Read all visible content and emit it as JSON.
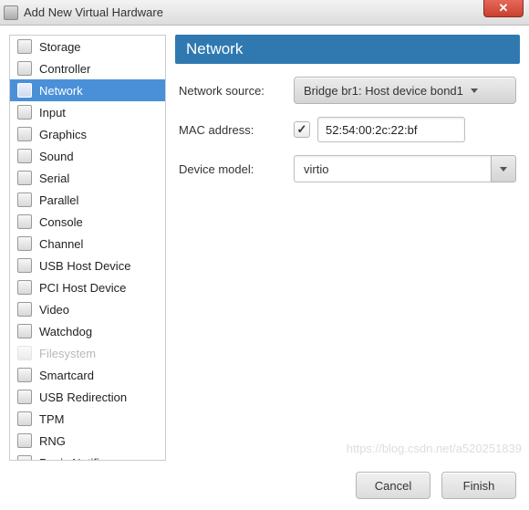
{
  "window": {
    "title": "Add New Virtual Hardware"
  },
  "sidebar": {
    "items": [
      {
        "label": "Storage",
        "icon": "storage-icon",
        "selected": false,
        "disabled": false
      },
      {
        "label": "Controller",
        "icon": "controller-icon",
        "selected": false,
        "disabled": false
      },
      {
        "label": "Network",
        "icon": "network-icon",
        "selected": true,
        "disabled": false
      },
      {
        "label": "Input",
        "icon": "input-icon",
        "selected": false,
        "disabled": false
      },
      {
        "label": "Graphics",
        "icon": "graphics-icon",
        "selected": false,
        "disabled": false
      },
      {
        "label": "Sound",
        "icon": "sound-icon",
        "selected": false,
        "disabled": false
      },
      {
        "label": "Serial",
        "icon": "serial-icon",
        "selected": false,
        "disabled": false
      },
      {
        "label": "Parallel",
        "icon": "parallel-icon",
        "selected": false,
        "disabled": false
      },
      {
        "label": "Console",
        "icon": "console-icon",
        "selected": false,
        "disabled": false
      },
      {
        "label": "Channel",
        "icon": "channel-icon",
        "selected": false,
        "disabled": false
      },
      {
        "label": "USB Host Device",
        "icon": "usb-icon",
        "selected": false,
        "disabled": false
      },
      {
        "label": "PCI Host Device",
        "icon": "pci-icon",
        "selected": false,
        "disabled": false
      },
      {
        "label": "Video",
        "icon": "video-icon",
        "selected": false,
        "disabled": false
      },
      {
        "label": "Watchdog",
        "icon": "watchdog-icon",
        "selected": false,
        "disabled": false
      },
      {
        "label": "Filesystem",
        "icon": "filesystem-icon",
        "selected": false,
        "disabled": true
      },
      {
        "label": "Smartcard",
        "icon": "smartcard-icon",
        "selected": false,
        "disabled": false
      },
      {
        "label": "USB Redirection",
        "icon": "usbredir-icon",
        "selected": false,
        "disabled": false
      },
      {
        "label": "TPM",
        "icon": "tpm-icon",
        "selected": false,
        "disabled": false
      },
      {
        "label": "RNG",
        "icon": "rng-icon",
        "selected": false,
        "disabled": false
      },
      {
        "label": "Panic Notifier",
        "icon": "panic-icon",
        "selected": false,
        "disabled": false
      }
    ]
  },
  "section": {
    "title": "Network"
  },
  "form": {
    "network_source": {
      "label": "Network source:",
      "value": "Bridge br1: Host device bond1"
    },
    "mac_address": {
      "label": "MAC address:",
      "checked": true,
      "check_glyph": "✓",
      "value": "52:54:00:2c:22:bf"
    },
    "device_model": {
      "label": "Device model:",
      "value": "virtio"
    }
  },
  "footer": {
    "cancel": "Cancel",
    "finish": "Finish"
  },
  "watermark": "https://blog.csdn.net/a520251839"
}
